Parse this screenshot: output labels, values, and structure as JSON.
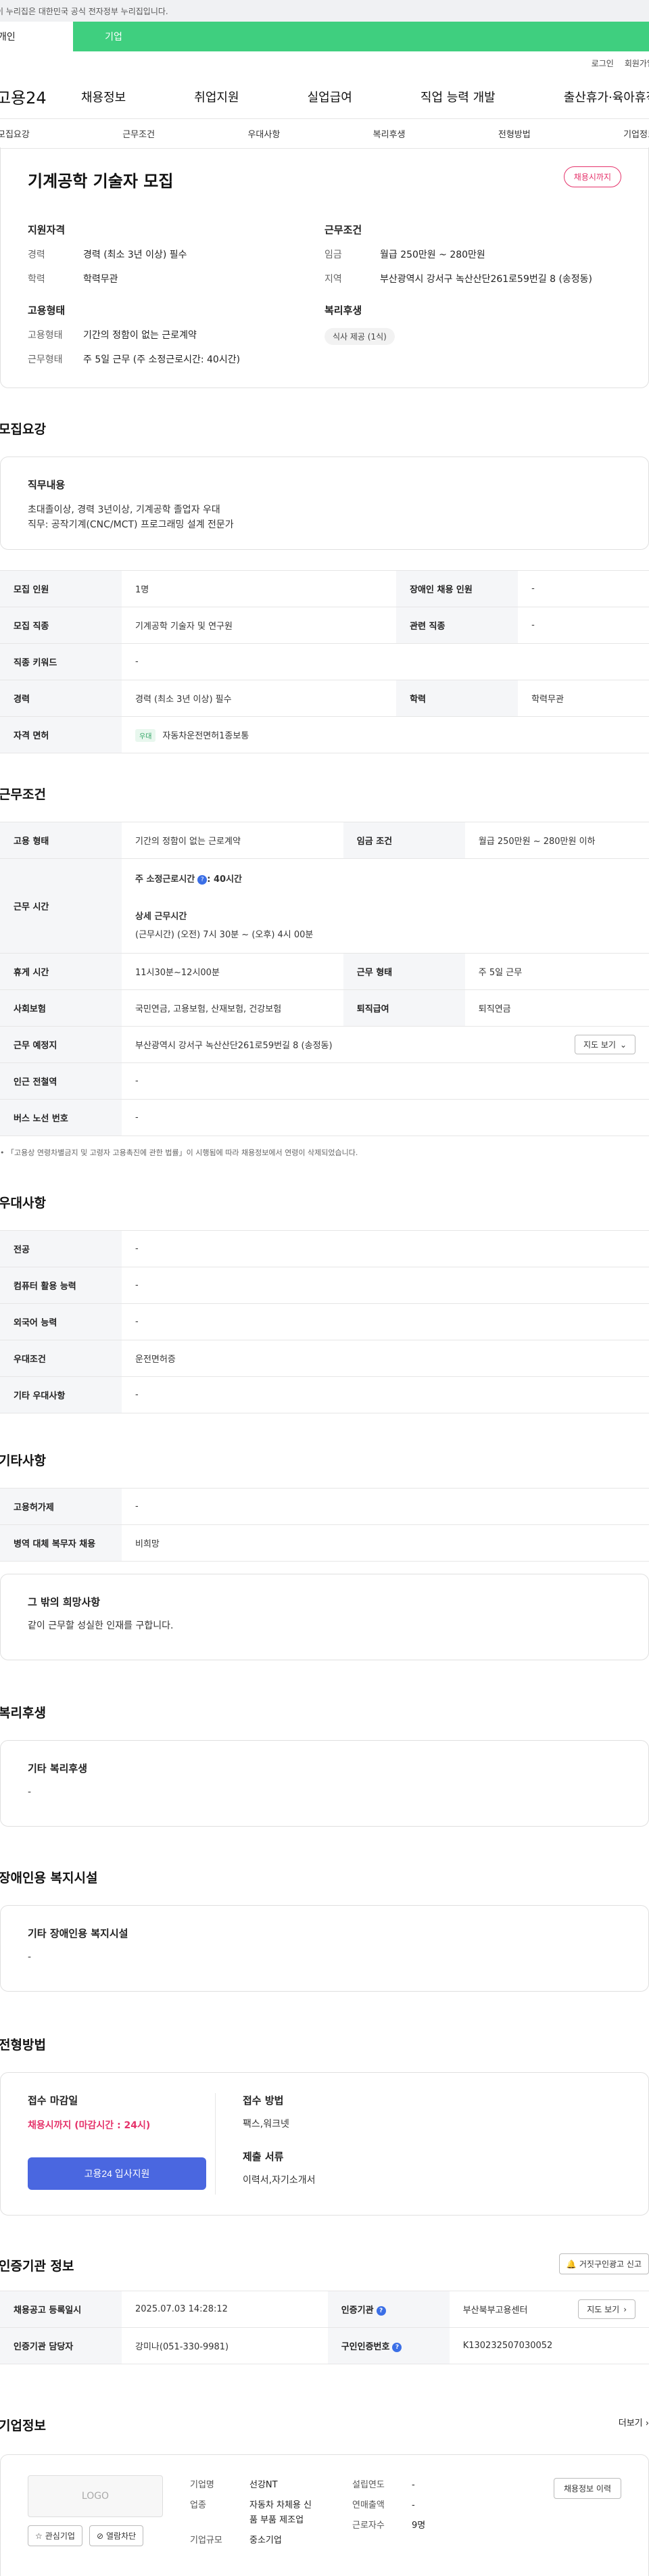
{
  "gov_banner": "이 누리집은 대한민국 공식 전자정부 누리집입니다.",
  "user_tabs": [
    "개인",
    "기업"
  ],
  "util_links": [
    "로그인",
    "회원가입"
  ],
  "logo": "고용24",
  "gnb": [
    "채용정보",
    "취업지원",
    "실업급여",
    "직업 능력 개발",
    "출산휴가·육아휴직"
  ],
  "anchor_nav": [
    "모집요강",
    "근무조건",
    "우대사항",
    "복리후생",
    "전형방법",
    "기업정보"
  ],
  "summary": {
    "title": "기계공학 기술자 모집",
    "status_pill": "채용시까지",
    "qual_h": "지원자격",
    "qual": [
      {
        "k": "경력",
        "v": "경력 (최소 3년 이상) 필수"
      },
      {
        "k": "학력",
        "v": "학력무관"
      }
    ],
    "emp_h": "고용형태",
    "emp": [
      {
        "k": "고용형태",
        "v": "기간의 정함이 없는 근로계약"
      },
      {
        "k": "근무형태",
        "v": "주 5일 근무 (주 소정근로시간: 40시간)"
      }
    ],
    "cond_h": "근무조건",
    "cond": [
      {
        "k": "임금",
        "v": "월급 250만원 ~ 280만원"
      },
      {
        "k": "지역",
        "v": "부산광역시 강서구 녹산산단261로59번길 8 (송정동)"
      }
    ],
    "welfare_h": "복리후생",
    "welfare_chip": "식사 제공 (1식)"
  },
  "recruit": {
    "title": "모집요강",
    "duty_h": "직무내용",
    "duty_1": "초대졸이상, 경력 3년이상, 기계공학 졸업자 우대",
    "duty_2": "직무: 공작기계(CNC/MCT) 프로그래밍 설계 전문가",
    "rows": {
      "count_k": "모집 인원",
      "count_v": "1명",
      "dis_k": "장애인 채용 인원",
      "dis_v": "-",
      "job_k": "모집 직종",
      "job_v": "기계공학 기술자 및 연구원",
      "rel_k": "관련 직종",
      "rel_v": "-",
      "kw_k": "직종 키워드",
      "kw_v": "-",
      "exp_k": "경력",
      "exp_v": "경력 (최소 3년 이상) 필수",
      "edu_k": "학력",
      "edu_v": "학력무관",
      "lic_k": "자격 면허",
      "lic_tag": "우대",
      "lic_v": "자동차운전면허1종보통"
    }
  },
  "work": {
    "title": "근무조건",
    "type_k": "고용 형태",
    "type_v": "기간의 정함이 없는 근로계약",
    "wage_k": "임금 조건",
    "wage_v": "월급 250만원 ~ 280만원 이하",
    "hours_k": "근무 시간",
    "hours_1": "주 소정근로시간",
    "hours_1v": ": 40시간",
    "hours_2": "상세 근무시간",
    "hours_3": "(근무시간) (오전) 7시 30분 ~ (오후) 4시 00분",
    "break_k": "휴게 시간",
    "break_v": "11시30분~12시00분",
    "form_k": "근무 형태",
    "form_v": "주 5일 근무",
    "ins_k": "사회보험",
    "ins_v": "국민연금, 고용보험, 산재보험, 건강보험",
    "ret_k": "퇴직급여",
    "ret_v": "퇴직연금",
    "place_k": "근무 예정지",
    "place_v": "부산광역시 강서구 녹산산단261로59번길 8 (송정동)",
    "map_btn": "지도 보기",
    "sub_k": "인근 전철역",
    "sub_v": "-",
    "bus_k": "버스 노선 번호",
    "bus_v": "-",
    "note": "「고용상 연령차별금지 및 고령자 고용촉진에 관한 법률」이 시행됨에 따라 채용정보에서 연령이 삭제되었습니다."
  },
  "pref": {
    "title": "우대사항",
    "major_k": "전공",
    "major_v": "-",
    "pc_k": "컴퓨터 활용 능력",
    "pc_v": "-",
    "lang_k": "외국어 능력",
    "lang_v": "-",
    "cond_k": "우대조건",
    "cond_v": "운전면허증",
    "etc_k": "기타 우대사항",
    "etc_v": "-"
  },
  "etc": {
    "title": "기타사항",
    "permit_k": "고용허가제",
    "permit_v": "-",
    "mil_k": "병역 대체 복무자 채용",
    "mil_v": "비희망",
    "hope_h": "그 밖의 희망사항",
    "hope_v": "같이 근무할 성실한 인재를 구합니다."
  },
  "welfare": {
    "title": "복리후생",
    "h": "기타 복리후생",
    "v": "-"
  },
  "disabled": {
    "title": "장애인용 복지시설",
    "h": "기타 장애인용 복지시설",
    "v": "-"
  },
  "selection": {
    "title": "전형방법",
    "deadline_h": "접수 마감일",
    "deadline_v": "채용시까지 (마감시간 : 24시)",
    "apply_btn": "고용24 입사지원",
    "method_h": "접수 방법",
    "method_v": "팩스,워크넷",
    "docs_h": "제출 서류",
    "docs_v": "이력서,자기소개서"
  },
  "cert": {
    "title": "인증기관 정보",
    "report_btn": "거짓구인광고 신고",
    "reg_k": "채용공고 등록일시",
    "reg_v": "2025.07.03 14:28:12",
    "org_k": "인증기관",
    "org_v": "부산북부고용센터",
    "map_btn": "지도 보기",
    "mgr_k": "인증기관 담당자",
    "mgr_v": "강미나(051-330-9981)",
    "no_k": "구인인증번호",
    "no_v": "K130232507030052"
  },
  "company": {
    "title": "기업정보",
    "more": "더보기",
    "logo": "LOGO",
    "fav_btn": "관심기업",
    "block_btn": "열람차단",
    "jobs_btn": "채용정보 이력",
    "name_k": "기업명",
    "name_v": "선강NT",
    "ind_k": "업종",
    "ind_v1": "자동차 차체용 신",
    "ind_v2": "품 부품 제조업",
    "size_k": "기업규모",
    "size_v": "중소기업",
    "est_k": "설립연도",
    "est_v": "-",
    "rev_k": "연매출액",
    "rev_v": "-",
    "emp_k": "근로자수",
    "emp_v": "9명"
  },
  "colors": {
    "green": "#3fcf7f",
    "red": "#e5336b",
    "blue": "#4a67e0"
  }
}
